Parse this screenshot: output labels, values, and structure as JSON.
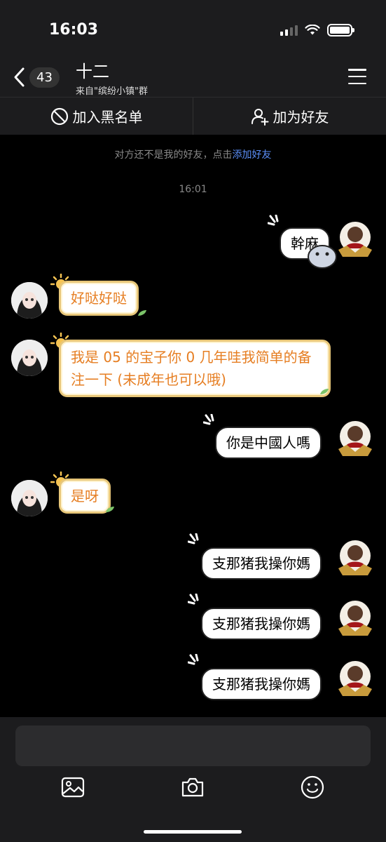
{
  "status": {
    "time": "16:03"
  },
  "nav": {
    "back_count": "43",
    "title": "十二",
    "subtitle": "来自\"缤纷小镇\"群"
  },
  "actions": {
    "block_label": "加入黑名单",
    "add_friend_label": "加为好友"
  },
  "notice": {
    "text": "对方还不是我的好友，点击",
    "link": "添加好友"
  },
  "timestamp": "16:01",
  "messages": [
    {
      "side": "right",
      "text": "幹麻"
    },
    {
      "side": "left",
      "text": "好哒好哒"
    },
    {
      "side": "left",
      "text": "我是 05 的宝子你 0 几年哇我简单的备注一下 (未成年也可以哦)"
    },
    {
      "side": "right",
      "text": "你是中國人嗎"
    },
    {
      "side": "left",
      "text": "是呀"
    },
    {
      "side": "right",
      "text": "支那猪我操你媽"
    },
    {
      "side": "right",
      "text": "支那猪我操你媽"
    },
    {
      "side": "right",
      "text": "支那猪我操你媽"
    }
  ],
  "colors": {
    "background": "#000000",
    "header": "#1c1c1e",
    "link": "#5b8ff9",
    "left_text": "#e67e22",
    "left_border": "#e8c77a"
  },
  "icons": [
    "back-arrow-icon",
    "menu-icon",
    "block-icon",
    "add-user-icon",
    "image-icon",
    "camera-icon",
    "emoji-icon"
  ]
}
